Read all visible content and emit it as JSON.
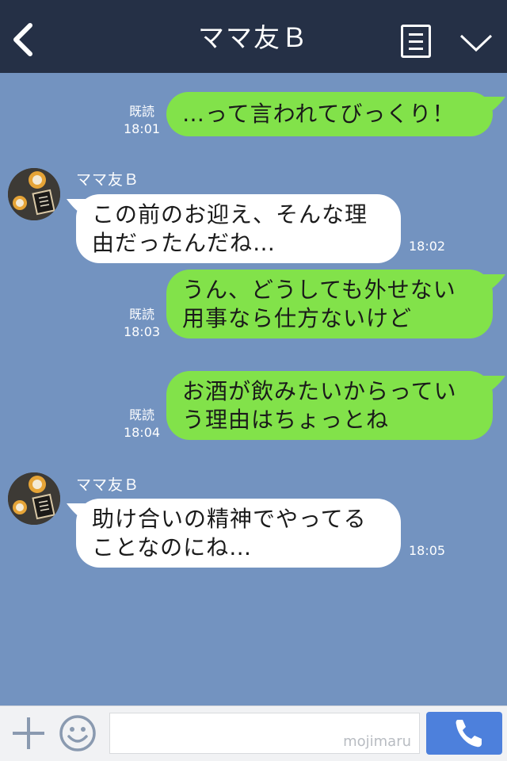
{
  "header": {
    "title": "ママ友Ｂ"
  },
  "messages": [
    {
      "side": "right",
      "text_lines": [
        "…って言われてびっくり！"
      ],
      "read_label": "既読",
      "time": "18:01"
    },
    {
      "side": "left",
      "sender": "ママ友Ｂ",
      "text_lines": [
        "この前のお迎え、そんな理",
        "由だったんだね…"
      ],
      "time": "18:02"
    },
    {
      "side": "right",
      "text_lines": [
        "うん、どうしても外せない",
        "用事なら仕方ないけど"
      ],
      "read_label": "既読",
      "time": "18:03"
    },
    {
      "side": "right",
      "text_lines": [
        "お酒が飲みたいからってい",
        "う理由はちょっとね"
      ],
      "read_label": "既読",
      "time": "18:04"
    },
    {
      "side": "left",
      "sender": "ママ友Ｂ",
      "text_lines": [
        "助け合いの精神でやってる",
        "ことなのにね…"
      ],
      "time": "18:05"
    }
  ],
  "input": {
    "watermark": "mojimaru",
    "value": ""
  },
  "icons": {
    "back": "chevron-left-icon",
    "menu": "note-icon",
    "more": "chevron-down-icon",
    "plus": "plus-icon",
    "emoji": "smiley-icon",
    "call": "phone-icon"
  },
  "colors": {
    "header_bg": "#253046",
    "chat_bg": "#7393c0",
    "sent_bubble": "#82e24a",
    "received_bubble": "#ffffff",
    "call_button": "#4d80dc"
  }
}
